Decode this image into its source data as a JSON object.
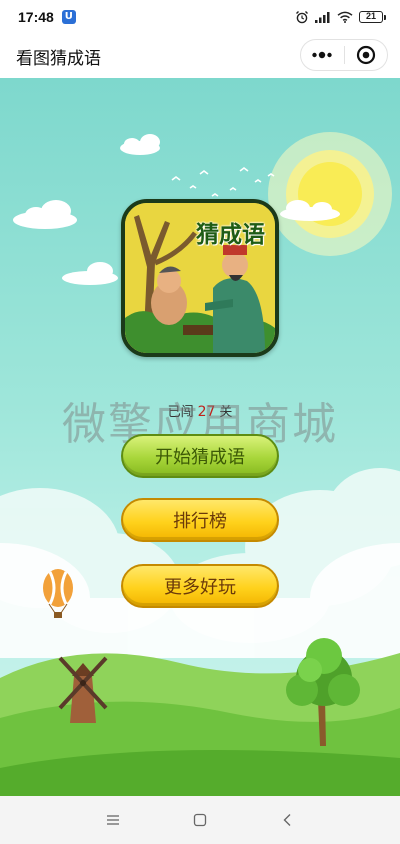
{
  "status_bar": {
    "time": "17:48",
    "app_badge": "U",
    "battery": "21"
  },
  "nav": {
    "title": "看图猜成语"
  },
  "logo": {
    "title": "猜成语"
  },
  "progress": {
    "prefix": "已闯",
    "level": "27",
    "suffix": "关"
  },
  "watermark": "微擎应用商城",
  "buttons": {
    "start": "开始猜成语",
    "ranking": "排行榜",
    "more": "更多好玩"
  },
  "colors": {
    "sky": "#7ed8cd",
    "green_button": "#a8d63a",
    "yellow_button": "#ffd21c",
    "level_number": "#c0231d"
  }
}
